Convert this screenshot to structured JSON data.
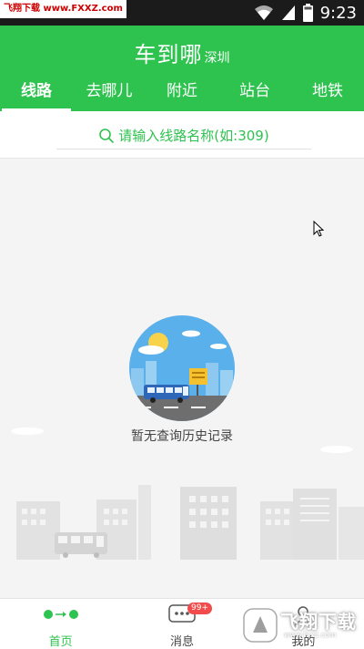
{
  "status_bar": {
    "time": "9:23",
    "watermark": "飞翔下载 www.FXXZ.com"
  },
  "header": {
    "app_title": "车到哪",
    "city": "深圳"
  },
  "tabs": [
    {
      "label": "线路",
      "active": true
    },
    {
      "label": "去哪儿",
      "active": false
    },
    {
      "label": "附近",
      "active": false
    },
    {
      "label": "站台",
      "active": false
    },
    {
      "label": "地铁",
      "active": false
    }
  ],
  "search": {
    "placeholder": "请输入线路名称(如:309)"
  },
  "empty_state": {
    "text": "暂无查询历史记录"
  },
  "bottom_nav": [
    {
      "label": "首页",
      "icon": "route-icon",
      "active": true
    },
    {
      "label": "消息",
      "icon": "chat-bubble-icon",
      "badge": "99+"
    },
    {
      "label": "我的",
      "icon": "user-icon"
    }
  ],
  "watermark_bottom": {
    "text": "飞翔下载",
    "url": "www.fxxz.com"
  },
  "colors": {
    "brand_green": "#2ec24f",
    "badge_red": "#f14b4b"
  }
}
